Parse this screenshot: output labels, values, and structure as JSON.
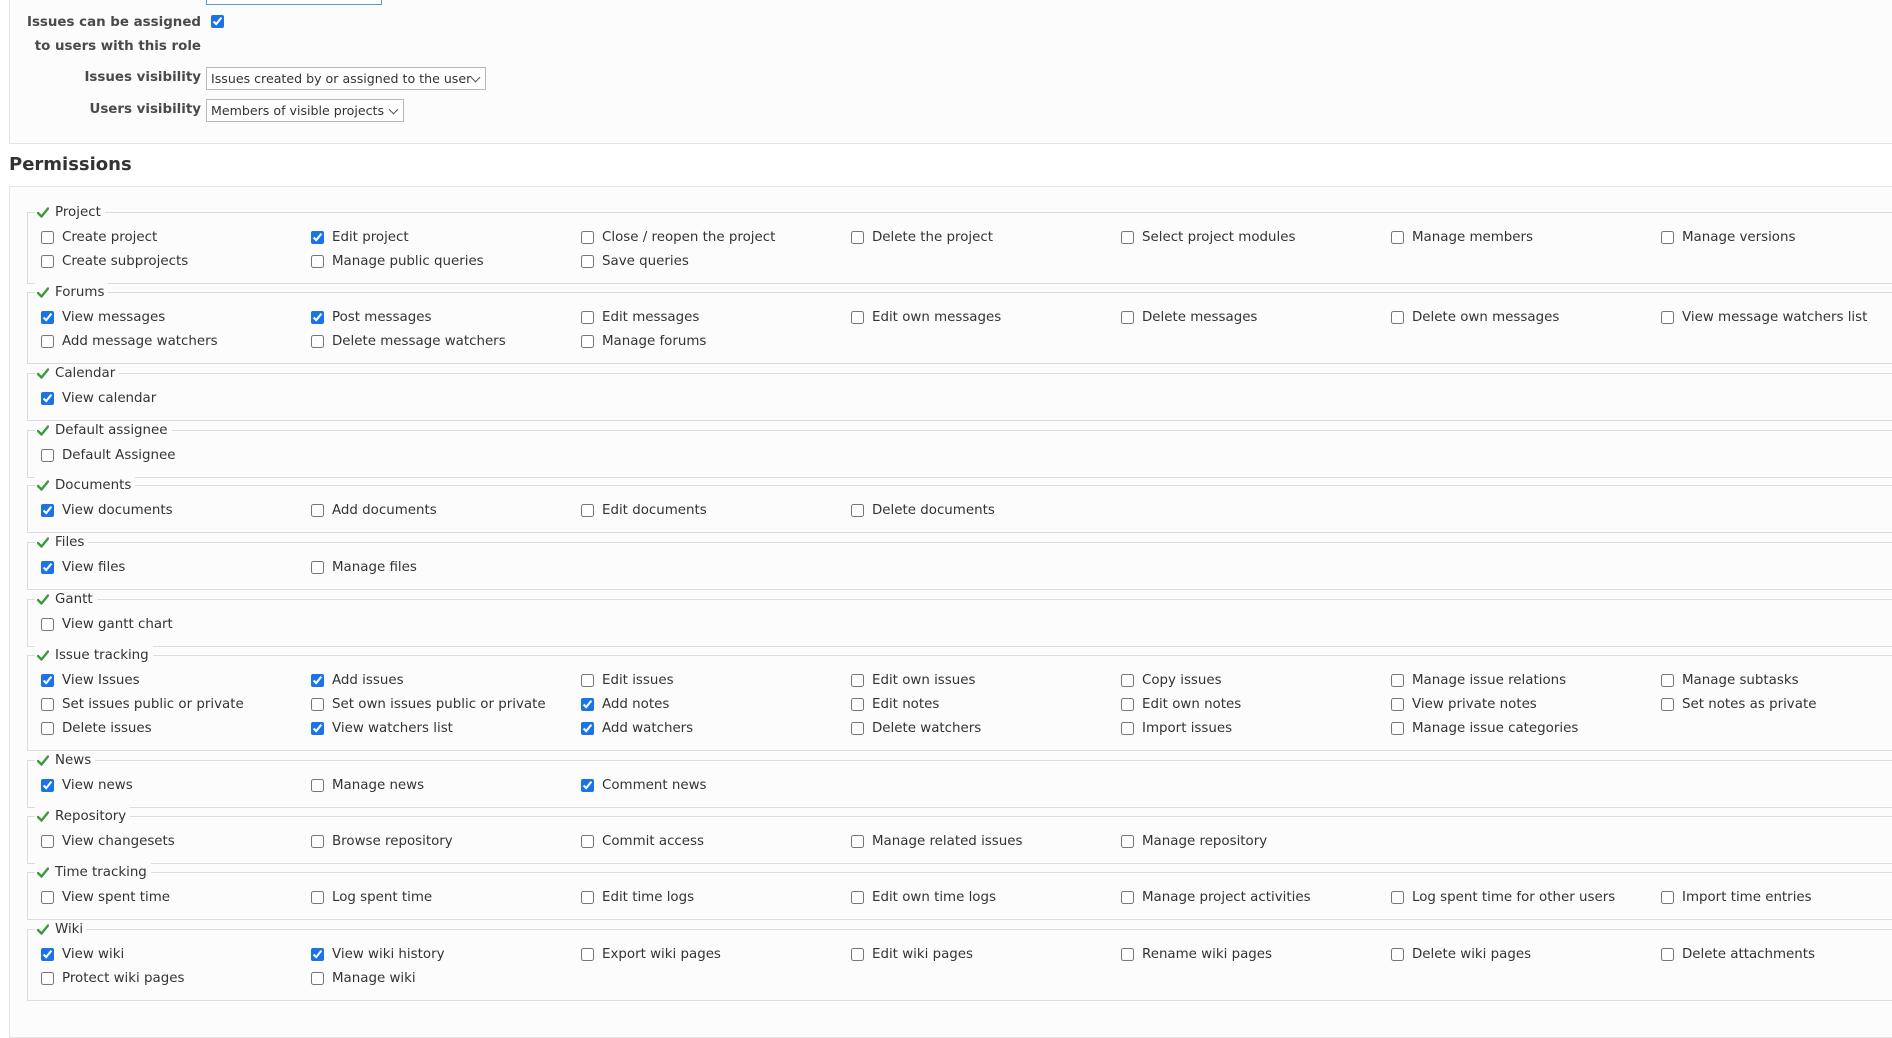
{
  "role_form": {
    "assignable_label_line1": "Issues can be assigned",
    "assignable_label_line2": "to users with this role",
    "assignable_checked": true,
    "issues_visibility_label": "Issues visibility",
    "issues_visibility_value": "Issues created by or assigned to the user",
    "users_visibility_label": "Users visibility",
    "users_visibility_value": "Members of visible projects"
  },
  "permissions_title": "Permissions",
  "colors": {
    "accent": "#1a73e8",
    "module_check": "#3c9a3c",
    "link": "#2e6aa8"
  },
  "icons": {
    "module": "check-icon",
    "dropdown": "chevron-down-icon"
  },
  "modules": [
    {
      "name": "Project",
      "rows": [
        [
          {
            "label": "Create project",
            "checked": false
          },
          {
            "label": "Edit project",
            "checked": true
          },
          {
            "label": "Close / reopen the project",
            "checked": false
          },
          {
            "label": "Delete the project",
            "checked": false
          },
          {
            "label": "Select project modules",
            "checked": false
          },
          {
            "label": "Manage members",
            "checked": false
          },
          {
            "label": "Manage versions",
            "checked": false
          }
        ],
        [
          {
            "label": "Create subprojects",
            "checked": false
          },
          {
            "label": "Manage public queries",
            "checked": false
          },
          {
            "label": "Save queries",
            "checked": false
          }
        ]
      ]
    },
    {
      "name": "Forums",
      "rows": [
        [
          {
            "label": "View messages",
            "checked": true
          },
          {
            "label": "Post messages",
            "checked": true
          },
          {
            "label": "Edit messages",
            "checked": false
          },
          {
            "label": "Edit own messages",
            "checked": false
          },
          {
            "label": "Delete messages",
            "checked": false
          },
          {
            "label": "Delete own messages",
            "checked": false
          },
          {
            "label": "View message watchers list",
            "checked": false
          }
        ],
        [
          {
            "label": "Add message watchers",
            "checked": false
          },
          {
            "label": "Delete message watchers",
            "checked": false
          },
          {
            "label": "Manage forums",
            "checked": false
          }
        ]
      ]
    },
    {
      "name": "Calendar",
      "rows": [
        [
          {
            "label": "View calendar",
            "checked": true
          }
        ]
      ]
    },
    {
      "name": "Default assignee",
      "rows": [
        [
          {
            "label": "Default Assignee",
            "checked": false
          }
        ]
      ]
    },
    {
      "name": "Documents",
      "rows": [
        [
          {
            "label": "View documents",
            "checked": true
          },
          {
            "label": "Add documents",
            "checked": false
          },
          {
            "label": "Edit documents",
            "checked": false
          },
          {
            "label": "Delete documents",
            "checked": false
          }
        ]
      ]
    },
    {
      "name": "Files",
      "rows": [
        [
          {
            "label": "View files",
            "checked": true
          },
          {
            "label": "Manage files",
            "checked": false
          }
        ]
      ]
    },
    {
      "name": "Gantt",
      "rows": [
        [
          {
            "label": "View gantt chart",
            "checked": false
          }
        ]
      ]
    },
    {
      "name": "Issue tracking",
      "rows": [
        [
          {
            "label": "View Issues",
            "checked": true
          },
          {
            "label": "Add issues",
            "checked": true
          },
          {
            "label": "Edit issues",
            "checked": false
          },
          {
            "label": "Edit own issues",
            "checked": false
          },
          {
            "label": "Copy issues",
            "checked": false
          },
          {
            "label": "Manage issue relations",
            "checked": false
          },
          {
            "label": "Manage subtasks",
            "checked": false
          }
        ],
        [
          {
            "label": "Set issues public or private",
            "checked": false
          },
          {
            "label": "Set own issues public or private",
            "checked": false
          },
          {
            "label": "Add notes",
            "checked": true
          },
          {
            "label": "Edit notes",
            "checked": false
          },
          {
            "label": "Edit own notes",
            "checked": false
          },
          {
            "label": "View private notes",
            "checked": false
          },
          {
            "label": "Set notes as private",
            "checked": false
          }
        ],
        [
          {
            "label": "Delete issues",
            "checked": false
          },
          {
            "label": "View watchers list",
            "checked": true
          },
          {
            "label": "Add watchers",
            "checked": true
          },
          {
            "label": "Delete watchers",
            "checked": false
          },
          {
            "label": "Import issues",
            "checked": false
          },
          {
            "label": "Manage issue categories",
            "checked": false
          }
        ]
      ]
    },
    {
      "name": "News",
      "rows": [
        [
          {
            "label": "View news",
            "checked": true
          },
          {
            "label": "Manage news",
            "checked": false
          },
          {
            "label": "Comment news",
            "checked": true
          }
        ]
      ]
    },
    {
      "name": "Repository",
      "rows": [
        [
          {
            "label": "View changesets",
            "checked": false
          },
          {
            "label": "Browse repository",
            "checked": false
          },
          {
            "label": "Commit access",
            "checked": false
          },
          {
            "label": "Manage related issues",
            "checked": false
          },
          {
            "label": "Manage repository",
            "checked": false
          }
        ]
      ]
    },
    {
      "name": "Time tracking",
      "rows": [
        [
          {
            "label": "View spent time",
            "checked": false
          },
          {
            "label": "Log spent time",
            "checked": false
          },
          {
            "label": "Edit time logs",
            "checked": false
          },
          {
            "label": "Edit own time logs",
            "checked": false
          },
          {
            "label": "Manage project activities",
            "checked": false
          },
          {
            "label": "Log spent time for other users",
            "checked": false
          },
          {
            "label": "Import time entries",
            "checked": false
          }
        ]
      ]
    },
    {
      "name": "Wiki",
      "rows": [
        [
          {
            "label": "View wiki",
            "checked": true
          },
          {
            "label": "View wiki history",
            "checked": true
          },
          {
            "label": "Export wiki pages",
            "checked": false
          },
          {
            "label": "Edit wiki pages",
            "checked": false
          },
          {
            "label": "Rename wiki pages",
            "checked": false
          },
          {
            "label": "Delete wiki pages",
            "checked": false
          },
          {
            "label": "Delete attachments",
            "checked": false
          }
        ],
        [
          {
            "label": "Protect wiki pages",
            "checked": false
          },
          {
            "label": "Manage wiki",
            "checked": false
          }
        ]
      ]
    }
  ]
}
